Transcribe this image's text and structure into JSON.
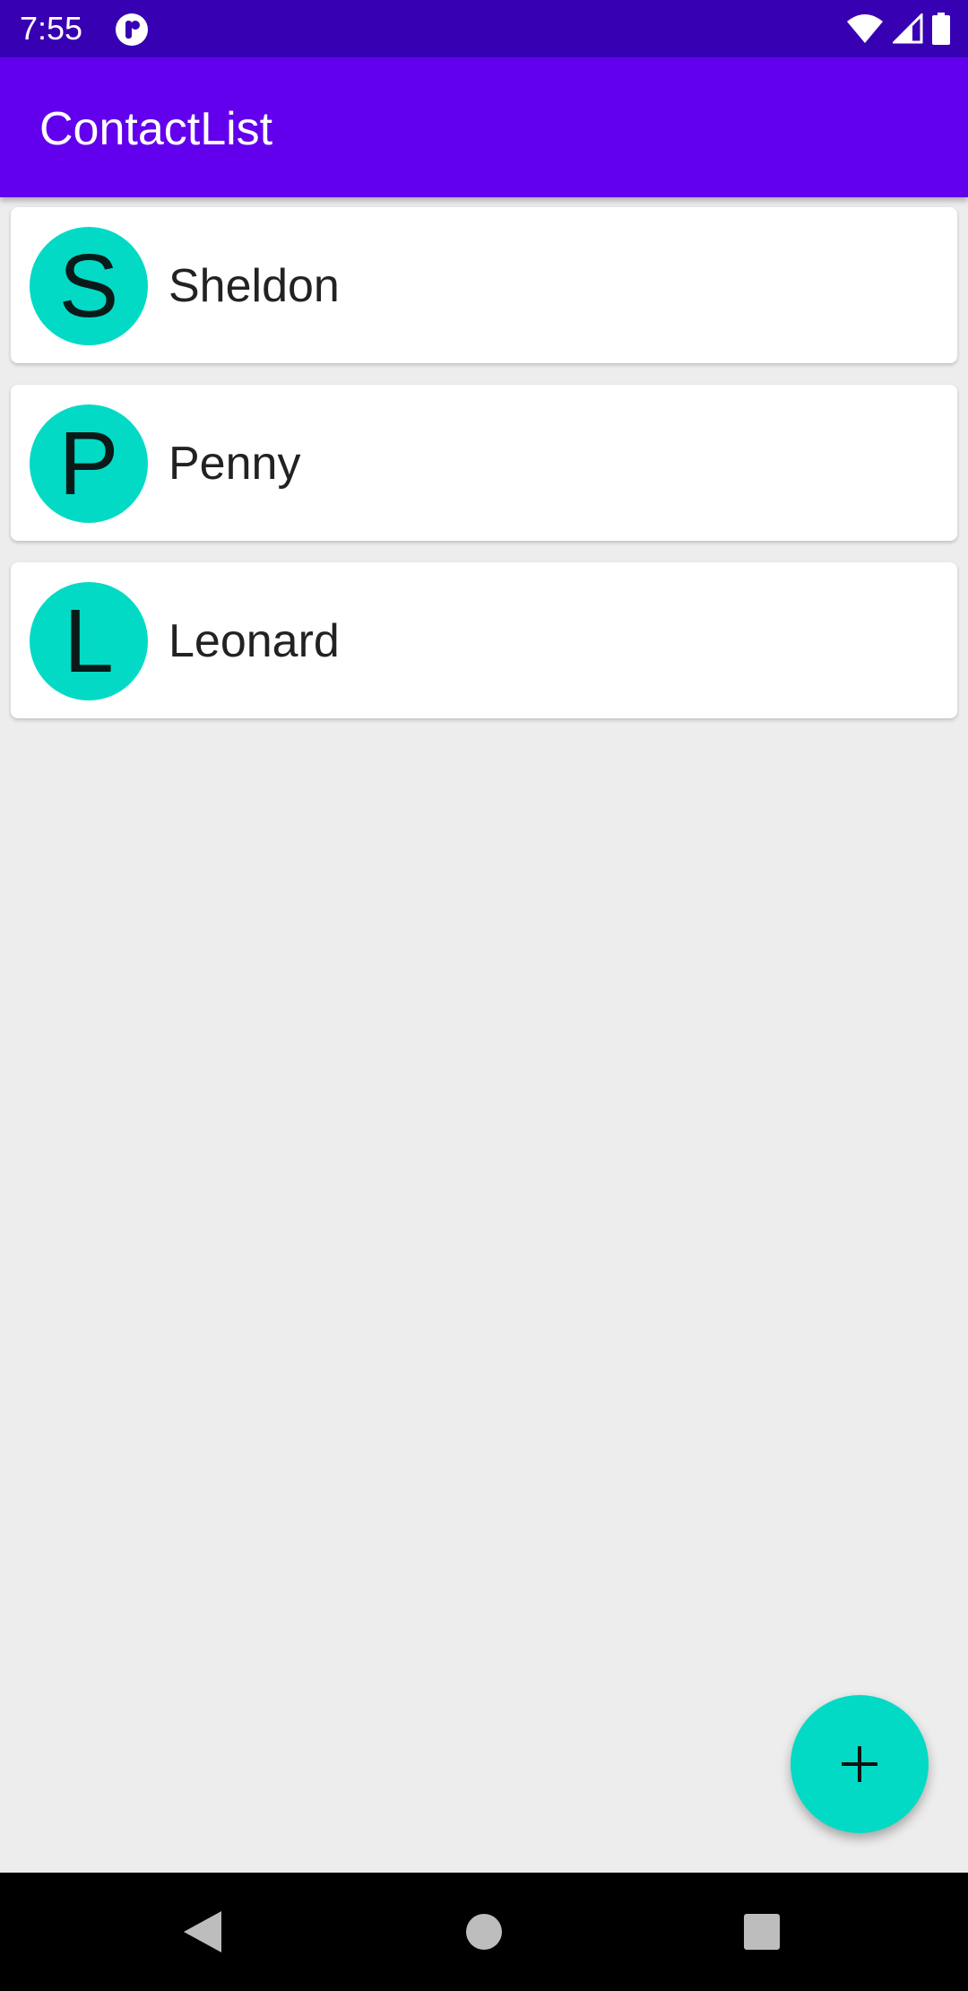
{
  "status_bar": {
    "time": "7:55",
    "app_icon": "notification-app-icon",
    "icons": [
      "wifi-icon",
      "signal-icon",
      "battery-icon"
    ]
  },
  "app_bar": {
    "title": "ContactList",
    "color": "#6200ee"
  },
  "contacts": [
    {
      "initial": "S",
      "name": "Sheldon"
    },
    {
      "initial": "P",
      "name": "Penny"
    },
    {
      "initial": "L",
      "name": "Leonard"
    }
  ],
  "fab": {
    "icon": "plus-icon",
    "color": "#03dac5"
  },
  "nav_bar": {
    "icons": [
      "back-icon",
      "home-icon",
      "recents-icon"
    ]
  },
  "colors": {
    "status_bar": "#3700b3",
    "accent": "#03dac5",
    "background": "#ededed"
  }
}
